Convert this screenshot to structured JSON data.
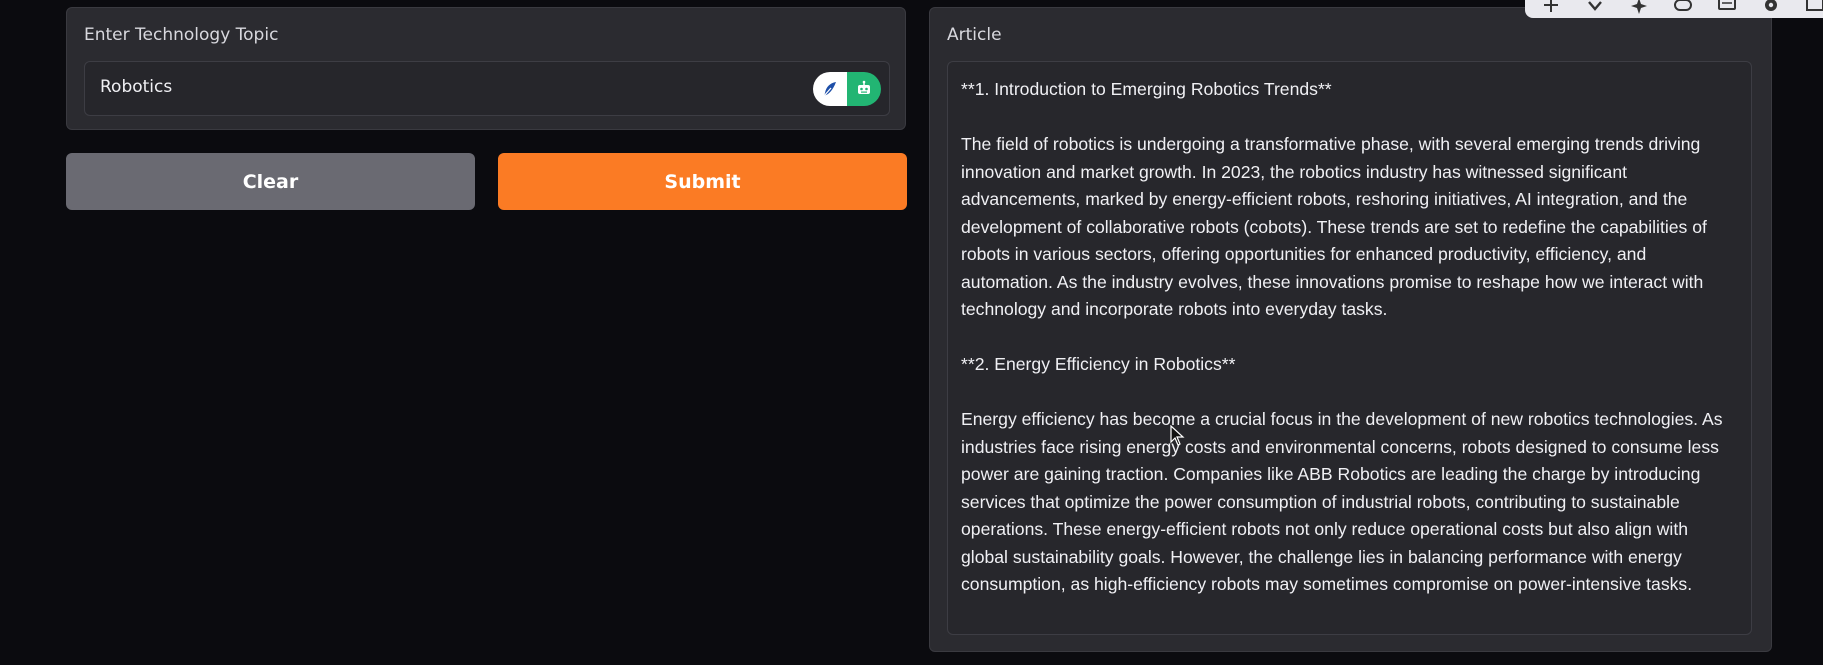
{
  "input_panel": {
    "label": "Enter Technology Topic",
    "value": "Robotics",
    "extension_icons": [
      "feather-icon",
      "robot-icon"
    ]
  },
  "buttons": {
    "clear_label": "Clear",
    "submit_label": "Submit"
  },
  "article": {
    "label": "Article",
    "paragraphs": [
      "**1. Introduction to Emerging Robotics Trends**",
      "The field of robotics is undergoing a transformative phase, with several emerging trends driving innovation and market growth. In 2023, the robotics industry has witnessed significant advancements, marked by energy-efficient robots, reshoring initiatives, AI integration, and the development of collaborative robots (cobots). These trends are set to redefine the capabilities of robots in various sectors, offering opportunities for enhanced productivity, efficiency, and automation. As the industry evolves, these innovations promise to reshape how we interact with technology and incorporate robots into everyday tasks.",
      "**2. Energy Efficiency in Robotics**",
      "Energy efficiency has become a crucial focus in the development of new robotics technologies. As industries face rising energy costs and environmental concerns, robots designed to consume less power are gaining traction. Companies like ABB Robotics are leading the charge by introducing services that optimize the power consumption of industrial robots, contributing to sustainable operations. These energy-efficient robots not only reduce operational costs but also align with global sustainability goals. However, the challenge lies in balancing performance with energy consumption, as high-efficiency robots may sometimes compromise on power-intensive tasks."
    ]
  },
  "toolbar": {
    "icons": [
      "move-icon",
      "download-icon",
      "sparkle-icon",
      "link-icon",
      "comment-icon",
      "settings-icon",
      "image-icon"
    ]
  },
  "colors": {
    "background": "#0b0b0f",
    "panel": "#2b2b30",
    "submit": "#fb7b24",
    "clear": "#6a6a72",
    "extension_green": "#22b573"
  }
}
